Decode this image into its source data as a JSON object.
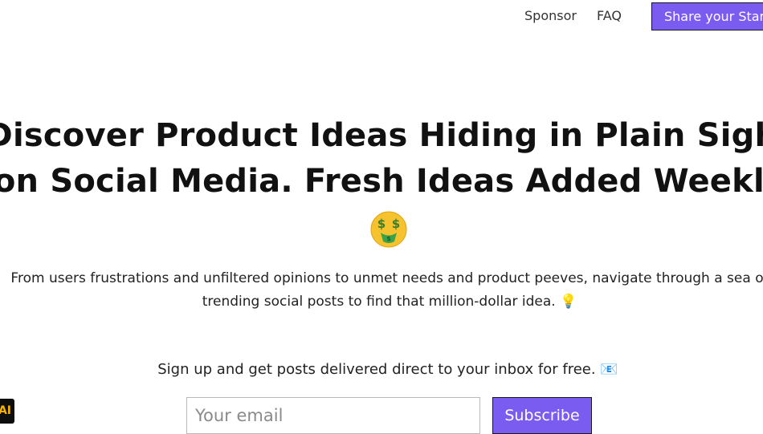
{
  "nav": {
    "sponsor": "Sponsor",
    "faq": "FAQ",
    "share_button": "Share your Startup"
  },
  "hero": {
    "headline_line1": "Discover Product Ideas Hiding in Plain Sight",
    "headline_line2": "on Social Media. Fresh Ideas Added Weekly",
    "headline_emoji": "money-mouth-face-icon",
    "description_line1": "From users frustrations and unfiltered opinions to unmet needs and product peeves, navigate through a sea of",
    "description_line2": "trending social posts to find that million-dollar idea. 💡"
  },
  "signup": {
    "text": "Sign up and get posts delivered direct to your inbox for free. 📧",
    "email_placeholder": "Your email",
    "subscribe_button": "Subscribe"
  },
  "badge": {
    "label": "AI"
  },
  "colors": {
    "accent": "#7b5cf0",
    "background": "#ffffff",
    "text": "#111111"
  }
}
